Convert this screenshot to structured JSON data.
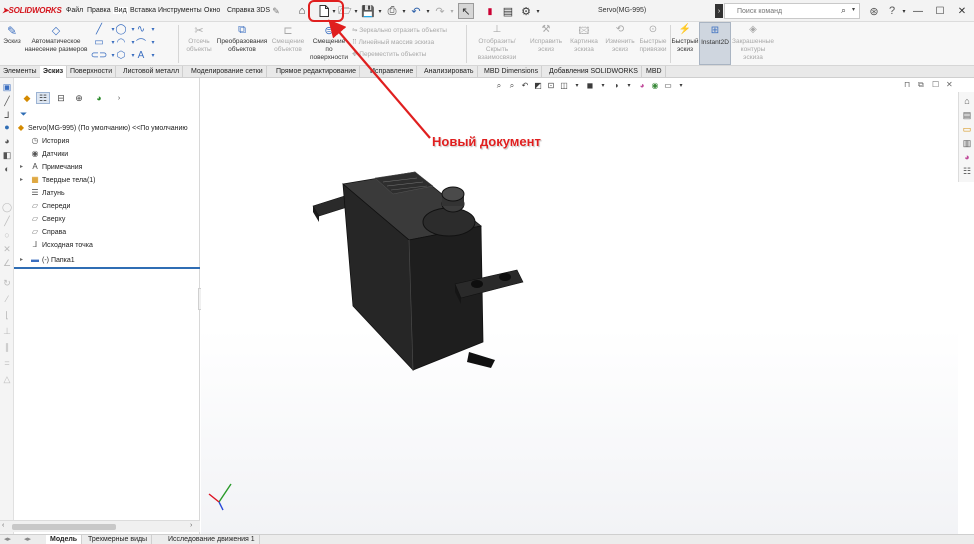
{
  "app": {
    "logo": "SOLIDWORKS",
    "document_title": "Servo(MG-995)",
    "menu": [
      "Файл",
      "Правка",
      "Вид",
      "Вставка",
      "Инструменты",
      "Окно",
      "Справка 3DS"
    ],
    "search_placeholder": "Поиск команд"
  },
  "ribbon": {
    "sketch": "Эскиз",
    "smart_dim_line1": "Автоматическое",
    "smart_dim_line2": "нанесение размеров",
    "trim_line1": "Отсечь",
    "trim_line2": "объекты",
    "convert_line1": "Преобразования",
    "convert_line2": "объектов",
    "offset_entities_line1": "Смещение",
    "offset_entities_line2": "объектов",
    "offset_surface_line1": "Смещение",
    "offset_surface_line2": "по",
    "offset_surface_line3": "поверхности",
    "mirror": "Зеркально отразить объекты",
    "linear_pattern": "Линейный массив эскиза",
    "move": "Переместить объекты",
    "show_hide_line1": "Отобразить/Скрыть",
    "show_hide_line2": "взаимосвязи",
    "repair_line1": "Исправить",
    "repair_line2": "эскиз",
    "picture_line1": "Картинка",
    "picture_line2": "эскиза",
    "modify_line1": "Изменить",
    "modify_line2": "эскиз",
    "quick_snaps_line1": "Быстрые",
    "quick_snaps_line2": "привязки",
    "rapid_sketch_line1": "Быстрый",
    "rapid_sketch_line2": "эскиз",
    "instant2d": "Instant2D",
    "shaded_line1": "Закрашенные",
    "shaded_line2": "контуры",
    "shaded_line3": "эскиза"
  },
  "command_tabs": [
    "Элементы",
    "Эскиз",
    "Поверхности",
    "Листовой металл",
    "Моделирование сетки",
    "Прямое редактирование",
    "Исправление",
    "Анализировать",
    "MBD Dimensions",
    "Добавления SOLIDWORKS",
    "MBD"
  ],
  "tree": {
    "root": "Servo(MG-995) (По умолчанию) <<По умолчанию",
    "items": [
      {
        "label": "История",
        "icon": "history-icon"
      },
      {
        "label": "Датчики",
        "icon": "sensors-icon"
      },
      {
        "label": "Примечания",
        "icon": "annotations-icon"
      },
      {
        "label": "Твердые тела(1)",
        "icon": "solid-bodies-icon"
      },
      {
        "label": "Латунь",
        "icon": "material-icon"
      },
      {
        "label": "Спереди",
        "icon": "plane-icon"
      },
      {
        "label": "Сверху",
        "icon": "plane-icon"
      },
      {
        "label": "Справа",
        "icon": "plane-icon"
      },
      {
        "label": "Исходная точка",
        "icon": "origin-icon"
      },
      {
        "label": "(-) Папка1",
        "icon": "folder-icon"
      }
    ]
  },
  "bottom_tabs": [
    "Модель",
    "Трехмерные виды",
    "Исследование движения 1"
  ],
  "annotation": {
    "text": "Новый документ",
    "color": "#e01f1f"
  },
  "colors": {
    "brand": "#d4141c",
    "accent": "#2f6db4"
  }
}
